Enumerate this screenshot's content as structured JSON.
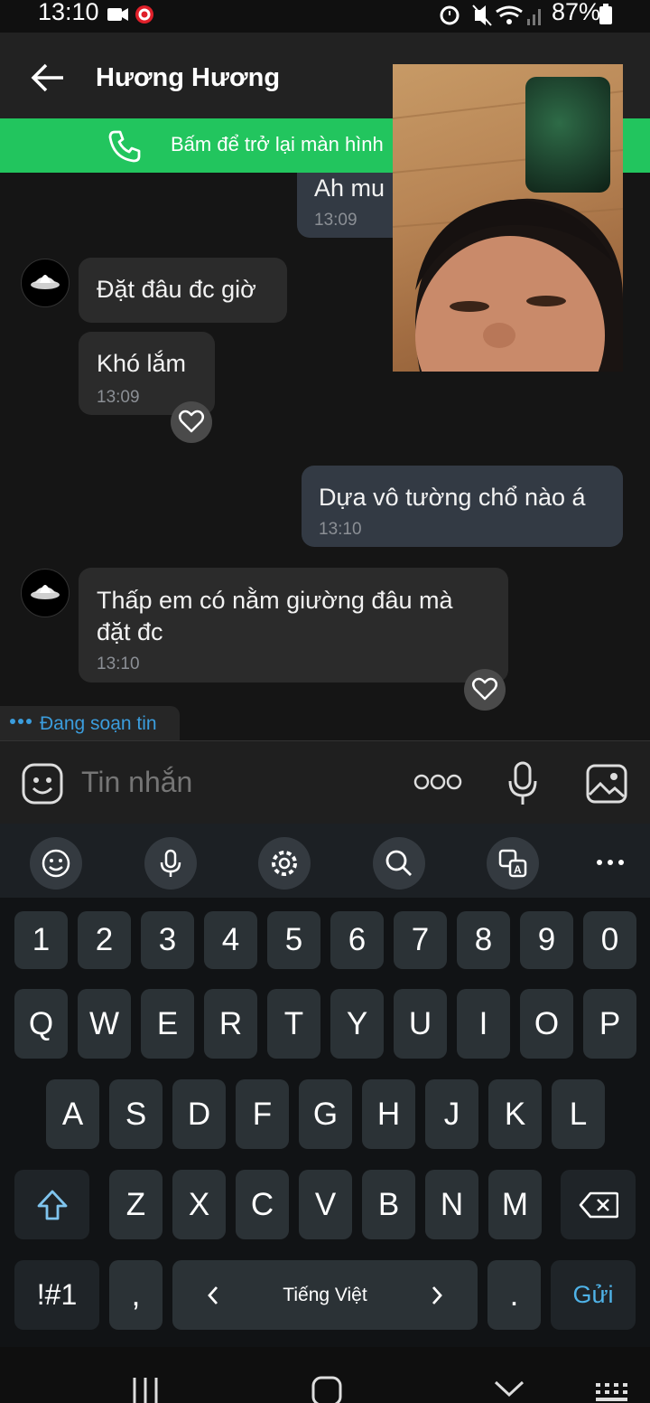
{
  "status_bar": {
    "time": "13:10",
    "battery": "87%"
  },
  "header": {
    "title": "Hương Hương"
  },
  "call_banner": {
    "text": "Bấm để trở lại màn hình"
  },
  "messages": [
    {
      "dir": "out",
      "text": "Ah mu",
      "time": "13:09"
    },
    {
      "dir": "in",
      "text": "Đặt đâu đc giờ"
    },
    {
      "dir": "in",
      "text": "Khó lắm",
      "time": "13:09"
    },
    {
      "dir": "out",
      "text": "Dựa vô tường chổ nào á",
      "time": "13:10"
    },
    {
      "dir": "in",
      "text_line1": "Thấp em có nằm giường đâu mà",
      "text_line2": "đặt đc",
      "time": "13:10"
    }
  ],
  "typing_indicator": "Đang soạn tin",
  "input": {
    "placeholder": "Tin nhắn"
  },
  "keyboard": {
    "number_row": [
      "1",
      "2",
      "3",
      "4",
      "5",
      "6",
      "7",
      "8",
      "9",
      "0"
    ],
    "row1": [
      "Q",
      "W",
      "E",
      "R",
      "T",
      "Y",
      "U",
      "I",
      "O",
      "P"
    ],
    "row2": [
      "A",
      "S",
      "D",
      "F",
      "G",
      "H",
      "J",
      "K",
      "L"
    ],
    "row3": [
      "Z",
      "X",
      "C",
      "V",
      "B",
      "N",
      "M"
    ],
    "symbols_key": "!#1",
    "comma": ",",
    "language": "Tiếng Việt",
    "period": ".",
    "send": "Gửi"
  },
  "icons": {
    "back": "arrow-left-icon",
    "phone": "phone-icon",
    "sticker": "sticker-icon",
    "more": "more-icon",
    "mic": "mic-icon",
    "gallery": "image-icon",
    "toolbar": [
      "emoji-icon",
      "mic-icon",
      "settings-icon",
      "search-icon",
      "translate-icon",
      "more-icon"
    ]
  },
  "colors": {
    "banner": "#22c55e",
    "accent": "#3b9ddd",
    "send": "#4fb3e8"
  }
}
